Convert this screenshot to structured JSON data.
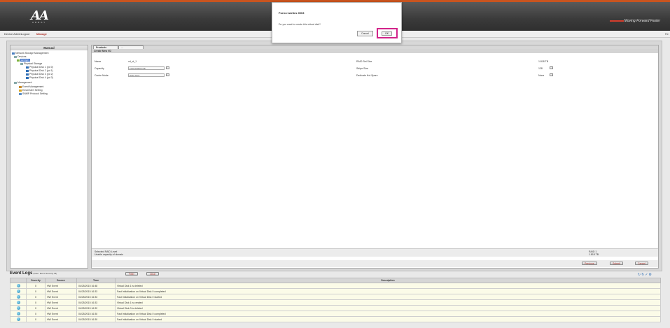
{
  "header": {
    "logo_text": "AA",
    "logo_sub": "ARRAY",
    "brand_text": "Moving Forward Faster"
  },
  "menubar": {
    "items": [
      "Device Admin",
      "Logout",
      "Manage"
    ],
    "right": "Re"
  },
  "nav": {
    "title": "Manual",
    "items": [
      "Network Storage Management",
      "Devices",
      "Array01",
      "Physical Storage",
      "Physical Disk 1 (pd 0)",
      "Physical Disk 2 (pd 1)",
      "Physical Disk 3 (pd 2)",
      "Physical Disk 4 (pd 3)",
      "Management",
      "Event Management",
      "Email Alert Setting",
      "SNMP Protocol Setting"
    ]
  },
  "content": {
    "tabs": [
      "Products",
      "..."
    ],
    "section_title": "Create New VD",
    "left_fields": [
      {
        "label": "Name",
        "value": "vd_ct_1"
      },
      {
        "label": "Capacity",
        "value": "1000.000000 GB"
      },
      {
        "label": "Cache Mode",
        "value": "Write-back"
      }
    ],
    "right_fields": [
      {
        "label": "RAID Set Size",
        "value": "1.818 TB"
      },
      {
        "label": "Stripe Size",
        "value": "128"
      },
      {
        "label": "Dedicate Hot Spare",
        "value": "None"
      }
    ],
    "status_left_1": "Selected RAID Level",
    "status_left_2": "Usable capacity of domain",
    "status_right_1": "RAID 1",
    "status_right_2": "1.818 TB",
    "actions": [
      "Previous",
      "Submit",
      "Cancel"
    ]
  },
  "events": {
    "title": "Event Logs",
    "subtitle": "(Filter: Event Severity All)",
    "buttons": [
      "Filter",
      "Clear"
    ],
    "toolbar_icons": [
      "refresh-icon",
      "refresh-icon",
      "check-icon",
      "settings-icon"
    ],
    "columns": [
      "Severity",
      "Code",
      "Time",
      "Source",
      "Description"
    ],
    "rows": [
      {
        "code": "0",
        "time": "04/25/2015 16:48",
        "source": "HW Event",
        "desc": "Virtual Disk 1 is deleted"
      },
      {
        "code": "0",
        "time": "04/25/2015 16:33",
        "source": "HW Event",
        "desc": "Fast Initialization on Virtual Disk 0 completed"
      },
      {
        "code": "0",
        "time": "04/25/2015 16:33",
        "source": "HW Event",
        "desc": "Fast Initialization on Virtual Disk 0 started"
      },
      {
        "code": "0",
        "time": "04/25/2015 16:33",
        "source": "HW Event",
        "desc": "Virtual Disk 1 is created"
      },
      {
        "code": "0",
        "time": "04/25/2015 16:32",
        "source": "HW Event",
        "desc": "Virtual Disk 0 is deleted"
      },
      {
        "code": "0",
        "time": "04/25/2015 16:30",
        "source": "HW Event",
        "desc": "Fast Initialization on Virtual Disk 0 completed"
      },
      {
        "code": "0",
        "time": "04/25/2015 16:30",
        "source": "HW Event",
        "desc": "Fast Initialization on Virtual Disk 0 started"
      }
    ]
  },
  "dialog": {
    "title": "Form rewrites 0003",
    "message": "Do you want to create this virtual disk?",
    "cancel_label": "Cancel",
    "ok_label": "OK"
  },
  "colors": {
    "header_accent": "#c9541f",
    "highlight": "#d2248a",
    "brand_red": "#d43d2c"
  }
}
